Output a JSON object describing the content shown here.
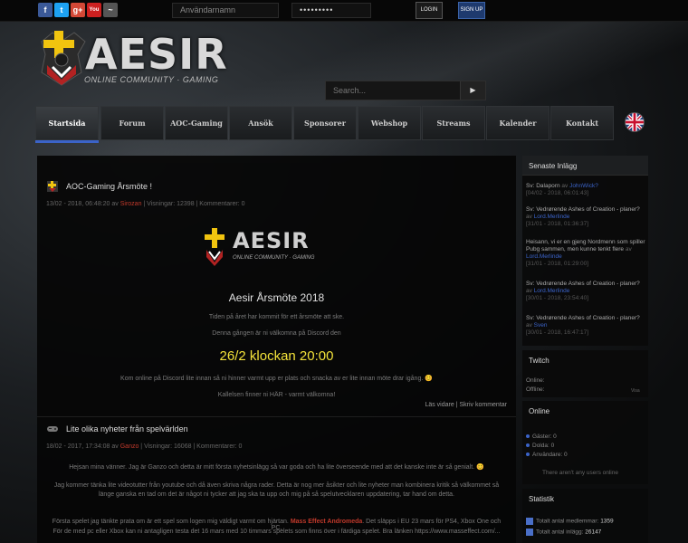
{
  "topbar": {
    "social": [
      {
        "icon": "facebook-icon",
        "label": "f",
        "color": "#3b5998"
      },
      {
        "icon": "twitter-icon",
        "label": "t",
        "color": "#1da1f2"
      },
      {
        "icon": "googleplus-icon",
        "label": "g+",
        "color": "#d34836"
      },
      {
        "icon": "youtube-icon",
        "label": "You",
        "color": "#cc2020"
      },
      {
        "icon": "other-icon",
        "label": "~",
        "color": "#555555"
      }
    ],
    "username_placeholder": "Användarnamn",
    "password_value": "•••••••••",
    "login_label": "LOGIN",
    "signup_label": "SIGN UP"
  },
  "brand": {
    "name": "AESIR",
    "tagline": "ONLINE COMMUNITY · GAMING"
  },
  "search": {
    "placeholder": "Search...",
    "button": "▶"
  },
  "nav": {
    "items": [
      "Startsida",
      "Forum",
      "AOC-Gaming",
      "Ansök",
      "Sponsorer",
      "Webshop",
      "Streams",
      "Kalender",
      "Kontakt"
    ],
    "accent": "#3b63c8"
  },
  "posts": [
    {
      "title": "AOC-Gaming Årsmöte !",
      "meta_prefix": "13/02 - 2018, 06:48:20 av ",
      "author": "Sirozan",
      "meta_suffix": " | Visningar: 12398 | Kommentarer: 0",
      "logo_text": "AESIR",
      "logo_sub": "ONLINE COMMUNITY · GAMING",
      "heading": "Aesir Årsmöte 2018",
      "line1": "Tiden på året har kommit för ett årsmöte att ske.",
      "line2": "Denna gången är ni välkomna på Discord den",
      "big": "26/2 klockan 20:00",
      "line3": "Kom online på Discord lite innan så ni hinner varmt upp er plats och snacka av er lite innan möte drar igång. 😊",
      "line4": "Kallelsen finner ni HÄR - varmt välkomna!",
      "read_more": "Läs vidare",
      "sep": "|",
      "comment": "Skriv kommentar"
    },
    {
      "title": "Lite olika nyheter från spelvärlden",
      "meta_prefix": "18/02 - 2017, 17:34:08 av ",
      "author": "Ganzo",
      "meta_suffix": " | Visningar: 16068 | Kommentarer: 0",
      "line1": "Hejsan mina vänner. Jag är Ganzo och detta är mitt första nyhetsinlägg så var goda och ha lite överseende med att det kanske inte är så genialt. 😊",
      "line2": "Jag kommer tänka lite videotutter från youtube och då även skriva några rader. Detta är nog mer åsikter och lite nyheter man kombinera kritik så välkommet så länge ganska en tad om det är något ni tycker att jag ska ta upp och mig på så spelutvecklaren uppdatering, tar hand om detta.",
      "line3_prefix": "Första spelet jag tänkte prata om är ett spel som logen mig väldigt varmt om hjärtan. ",
      "line3_highlight": "Mass Effect Andromeda",
      "line3_suffix": ". Det släpps i EU 23 mars för PS4, Xbox One och PC.",
      "line4": "För de med pc eller Xbox kan ni antagligen testa det 16 mars med 10 timmars spelets som finns över i färdiga spelet. Bra länken https://www.masseffect.com/..."
    }
  ],
  "sidebar": {
    "recent_title": "Senaste Inlägg",
    "recent": [
      {
        "text": "Sv: Dalaporn",
        "by": " av ",
        "user": "JohnWick?",
        "date": "[04/02 - 2018, 06:01:43]"
      },
      {
        "text": "Sv: Vedrørende Ashes of Creation - planer?",
        "by": " av ",
        "user": "Lord.Merlinde",
        "date": "[31/01 - 2018, 01:36:37]"
      },
      {
        "text": "Heisann, vi er en gjeng Nordmenn som spiller Pubg sammen, men kunne tenkt flere",
        "by": " av ",
        "user": "Lord.Merlinde",
        "date": "[31/01 - 2018, 01:29:00]"
      },
      {
        "text": "Sv: Vedrørende Ashes of Creation - planer?",
        "by": " av ",
        "user": "Lord.Merlinde",
        "date": "[30/01 - 2018, 23:54:40]"
      },
      {
        "text": "Sv: Vedrørende Ashes of Creation - planer?",
        "by": " av ",
        "user": "Sven",
        "date": "[30/01 - 2018, 16:47:17]"
      }
    ],
    "twitch_title": "Twitch",
    "twitch_online": "Online:",
    "twitch_offline": "Offline:",
    "twitch_more": "Visa",
    "online_title": "Online",
    "online_guests": "Gäster: 0",
    "online_hidden": "Dolda: 0",
    "online_users": "Användare: 0",
    "online_none": "There aren't any users online",
    "stats_title": "Statistik",
    "stat1_label": "Totalt antal medlemmar:",
    "stat1_value": "1359",
    "stat2_label": "Totalt antal inlägg:",
    "stat2_value": "26147"
  },
  "colors": {
    "accent_blue": "#3b63c8",
    "author_red": "#c0392b",
    "highlight_yellow": "#f3e23a"
  }
}
